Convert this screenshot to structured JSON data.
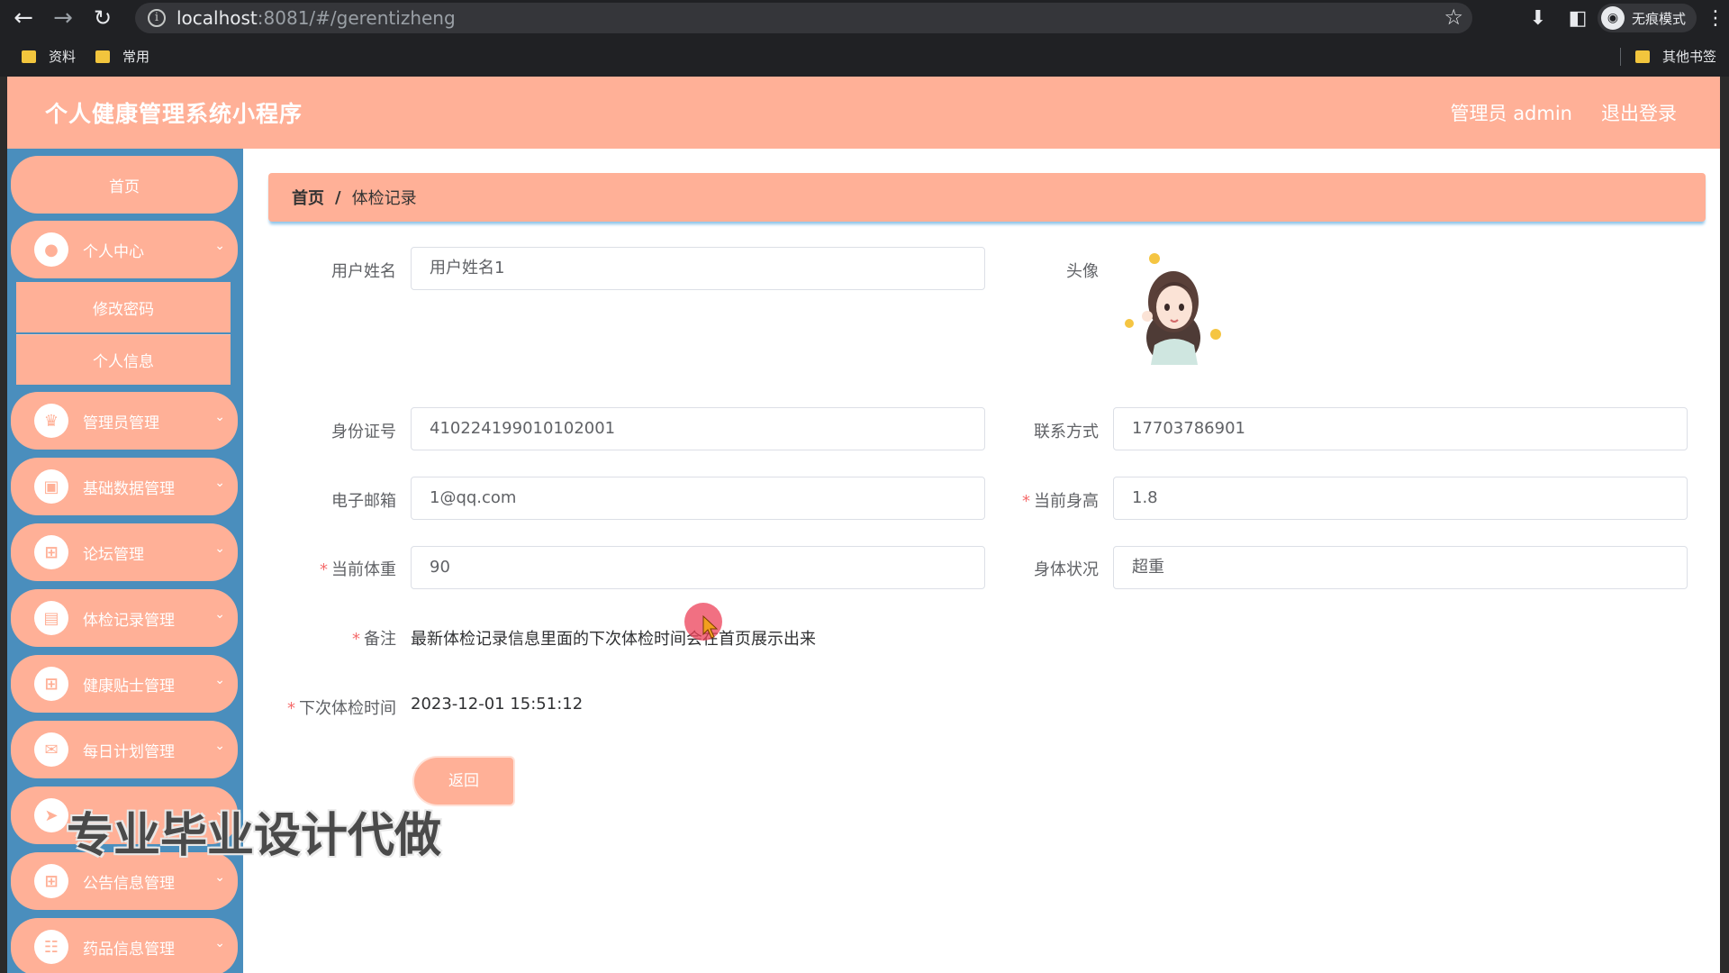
{
  "browser": {
    "url_host": "localhost",
    "url_path": ":8081/#/gerentizheng",
    "incognito_label": "无痕模式",
    "bookmarks": [
      "资料",
      "常用"
    ],
    "other_bookmarks": "其他书签"
  },
  "header": {
    "app_title": "个人健康管理系统小程序",
    "user_label": "管理员 admin",
    "logout_label": "退出登录"
  },
  "sidebar": {
    "home": "首页",
    "items": [
      {
        "label": "个人中心",
        "icon": "user-icon"
      },
      {
        "label": "管理员管理",
        "icon": "admin-icon"
      },
      {
        "label": "基础数据管理",
        "icon": "monitor-icon"
      },
      {
        "label": "论坛管理",
        "icon": "grid-icon"
      },
      {
        "label": "体检记录管理",
        "icon": "chart-icon"
      },
      {
        "label": "健康贴士管理",
        "icon": "grid-icon"
      },
      {
        "label": "每日计划管理",
        "icon": "message-icon"
      },
      {
        "label": "",
        "icon": "send-icon"
      },
      {
        "label": "公告信息管理",
        "icon": "grid-icon"
      },
      {
        "label": "药品信息管理",
        "icon": "clipboard-icon"
      }
    ],
    "submenu": [
      "修改密码",
      "个人信息"
    ]
  },
  "breadcrumb": {
    "home": "首页",
    "separator": "/",
    "current": "体检记录"
  },
  "form": {
    "username": {
      "label": "用户姓名",
      "value": "用户姓名1"
    },
    "avatar": {
      "label": "头像"
    },
    "id_number": {
      "label": "身份证号",
      "value": "410224199010102001"
    },
    "phone": {
      "label": "联系方式",
      "value": "17703786901"
    },
    "email": {
      "label": "电子邮箱",
      "value": "1@qq.com"
    },
    "height": {
      "label": "当前身高",
      "value": "1.8"
    },
    "weight": {
      "label": "当前体重",
      "value": "90"
    },
    "condition": {
      "label": "身体状况",
      "value": "超重"
    },
    "remark": {
      "label": "备注",
      "value": "最新体检记录信息里面的下次体检时间会在首页展示出来"
    },
    "next_exam": {
      "label": "下次体检时间",
      "value": "2023-12-01 15:51:12"
    },
    "back_button": "返回"
  },
  "overlay": {
    "watermark": "专业毕业设计代做"
  },
  "colors": {
    "accent": "#ffb097",
    "sidebar_bg": "#4a8ebd",
    "required": "#f56c6c"
  }
}
